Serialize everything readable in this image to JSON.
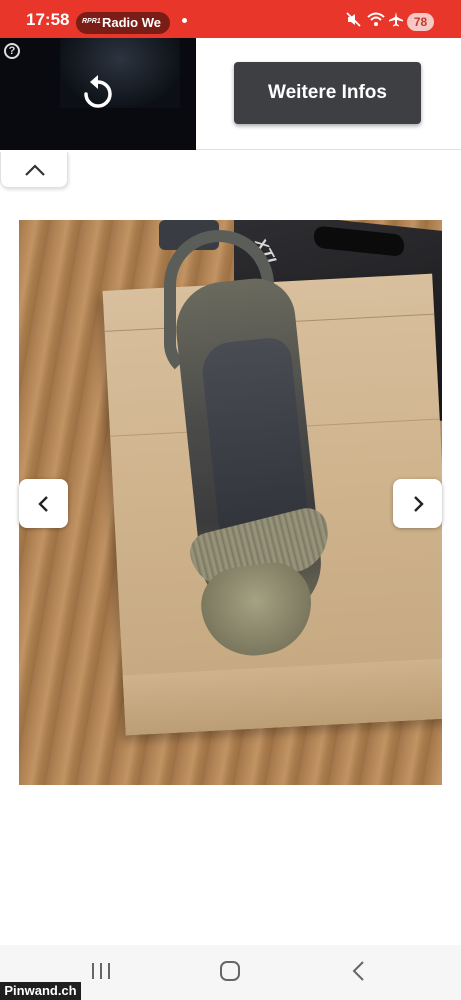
{
  "status_bar": {
    "time": "17:58",
    "radio_logo": "RPR1",
    "radio_name": "Radio We",
    "battery": "78",
    "icons": [
      "mute-icon",
      "wifi-icon",
      "airplane-icon"
    ]
  },
  "ad": {
    "button_label": "Weitere Infos",
    "help_glyph": "?",
    "icons": [
      "help-icon",
      "replay-icon"
    ]
  },
  "collapse": {
    "icon": "chevron-up-icon"
  },
  "gallery": {
    "image_subject": "shoe-photo",
    "box_text": "XTI",
    "prev_icon": "chevron-left-icon",
    "next_icon": "chevron-right-icon"
  },
  "system_nav": {
    "icons": [
      "recent-apps-icon",
      "home-icon",
      "back-icon"
    ]
  },
  "watermark": {
    "text": "Pinwand.ch"
  },
  "colors": {
    "status_bar": "#e8362a",
    "ad_button": "#3d3f43",
    "system_nav": "#f6f6f6"
  }
}
